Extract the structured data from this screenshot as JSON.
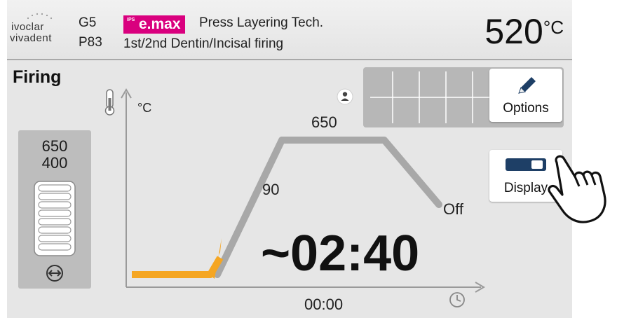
{
  "header": {
    "logo_line1": "ivoclar",
    "logo_line2": "vivadent",
    "program_group": "G5",
    "program_number": "P83",
    "material_badge": "e.max",
    "badge_prefix": "IPS",
    "program_title": "Press Layering Tech.",
    "program_subtitle": "1st/2nd Dentin/Incisal firing",
    "temperature": "520",
    "temperature_unit": "°C"
  },
  "section_title": "Firing",
  "temp_panel": {
    "value1": "650",
    "value2": "400"
  },
  "chart": {
    "y_unit": "°C",
    "hold_temp": "650",
    "rate": "90",
    "end_state": "Off",
    "time_remaining": "~02:40",
    "start_time": "00:00"
  },
  "buttons": {
    "options_label": "Options",
    "display_label": "Display"
  },
  "colors": {
    "curve_active": "#f5a623",
    "curve_inactive": "#a8a8a8",
    "badge": "#d9007e",
    "toggle": "#1e3f66"
  }
}
